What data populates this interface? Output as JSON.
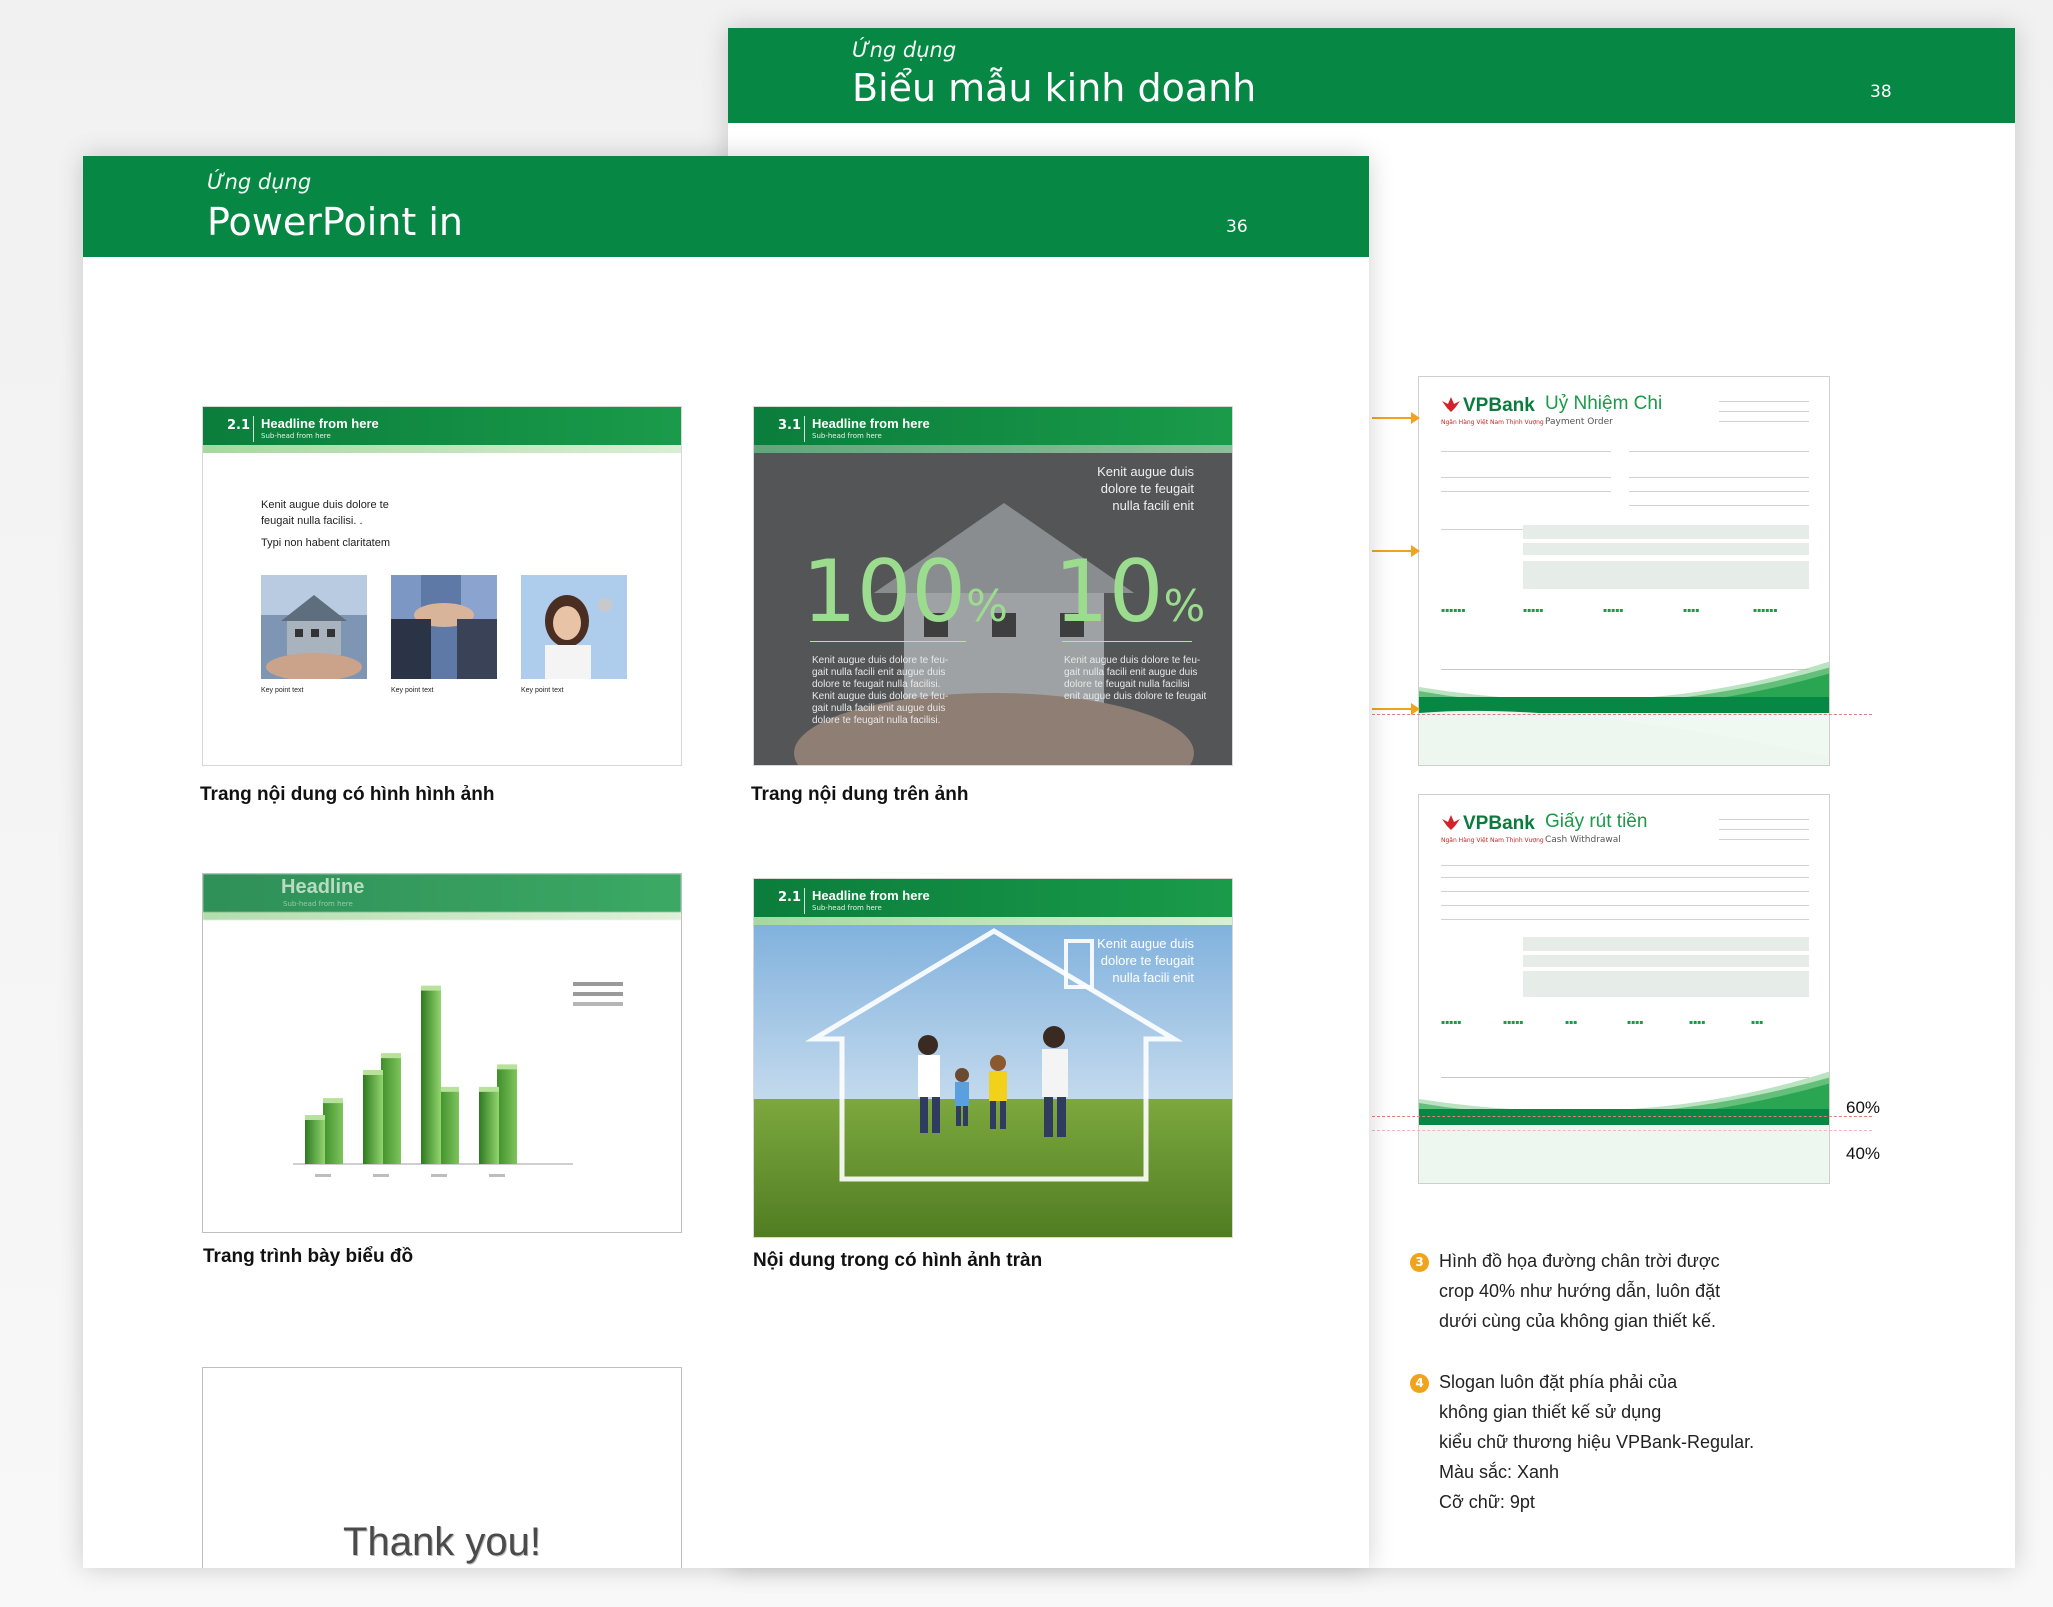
{
  "back_page": {
    "section": "Ứng dụng",
    "title": "Biểu mẫu kinh doanh",
    "page_number": "38",
    "form1": {
      "brand": "VPBank",
      "brand_sub": "Ngân Hàng Việt Nam Thịnh Vượng",
      "title": "Uỷ Nhiệm Chi",
      "subtitle": "Payment Order"
    },
    "form2": {
      "brand": "VPBank",
      "brand_sub": "Ngân Hàng Việt Nam Thịnh Vượng",
      "title": "Giấy rút tiền",
      "subtitle": "Cash Withdrawal"
    },
    "pct_60": "60%",
    "pct_40": "40%",
    "notes": [
      {
        "num": "3",
        "lines": [
          "Hình đồ họa đường chân trời được",
          "crop 40% như hướng dẫn, luôn đặt",
          "dưới cùng của không gian thiết kế."
        ]
      },
      {
        "num": "4",
        "lines": [
          "Slogan luôn đặt phía phải của",
          "không gian thiết kế sử dụng",
          "kiểu chữ thương hiệu VPBank-Regular.",
          "Màu sắc: Xanh",
          "Cỡ chữ: 9pt"
        ]
      }
    ]
  },
  "front_page": {
    "section": "Ứng dụng",
    "title": "PowerPoint in",
    "page_number": "36",
    "slides": [
      {
        "num": "2.1",
        "headline": "Headline from here",
        "subhead": "Sub-head from here",
        "body1": "Kenit augue duis dolore te",
        "body2": "feugait nulla facilisi. .",
        "body3": "Typi non habent claritatem",
        "key1": "Key point text",
        "key2": "Key point text",
        "key3": "Key point text",
        "caption": "Trang nội dung có hình hình ảnh"
      },
      {
        "num": "3.1",
        "headline": "Headline from here",
        "subhead": "Sub-head from here",
        "corner1": "Kenit augue duis",
        "corner2": "dolore te feugait",
        "corner3": "nulla facili enit",
        "stat1": "100",
        "stat2": "10",
        "pct_sign": "%",
        "col1": [
          "Kenit augue duis dolore te feu-",
          "gait nulla facili enit augue duis",
          "dolore te feugait nulla facilisi.",
          "Kenit augue duis dolore te feu-",
          "gait nulla facili enit augue duis",
          "dolore te feugait nulla facilisi."
        ],
        "col2": [
          "Kenit augue duis dolore te feu-",
          "gait nulla facili enit augue duis",
          "dolore te feugait nulla facilisi",
          "enit augue duis dolore te feugait"
        ],
        "caption": "Trang nội dung trên ảnh"
      },
      {
        "headline": "Headline",
        "subhead": "Sub-head from here",
        "caption": "Trang trình bày biểu đồ"
      },
      {
        "num": "2.1",
        "headline": "Headline from here",
        "subhead": "Sub-head from here",
        "corner1": "Kenit augue duis",
        "corner2": "dolore te feugait",
        "corner3": "nulla facili enit",
        "caption": "Nội dung trong có hình ảnh tràn"
      },
      {
        "text": "Thank you!"
      }
    ]
  },
  "chart_data": {
    "type": "bar",
    "categories": [
      "",
      "",
      "",
      ""
    ],
    "series": [
      {
        "values": [
          55,
          95,
          65,
          85
        ]
      },
      {
        "values": [
          40,
          80,
          155,
          65
        ]
      }
    ],
    "ylim": [
      0,
      160
    ]
  },
  "colors": {
    "brand_green": "#078744",
    "accent_orange": "#f0a31d"
  }
}
